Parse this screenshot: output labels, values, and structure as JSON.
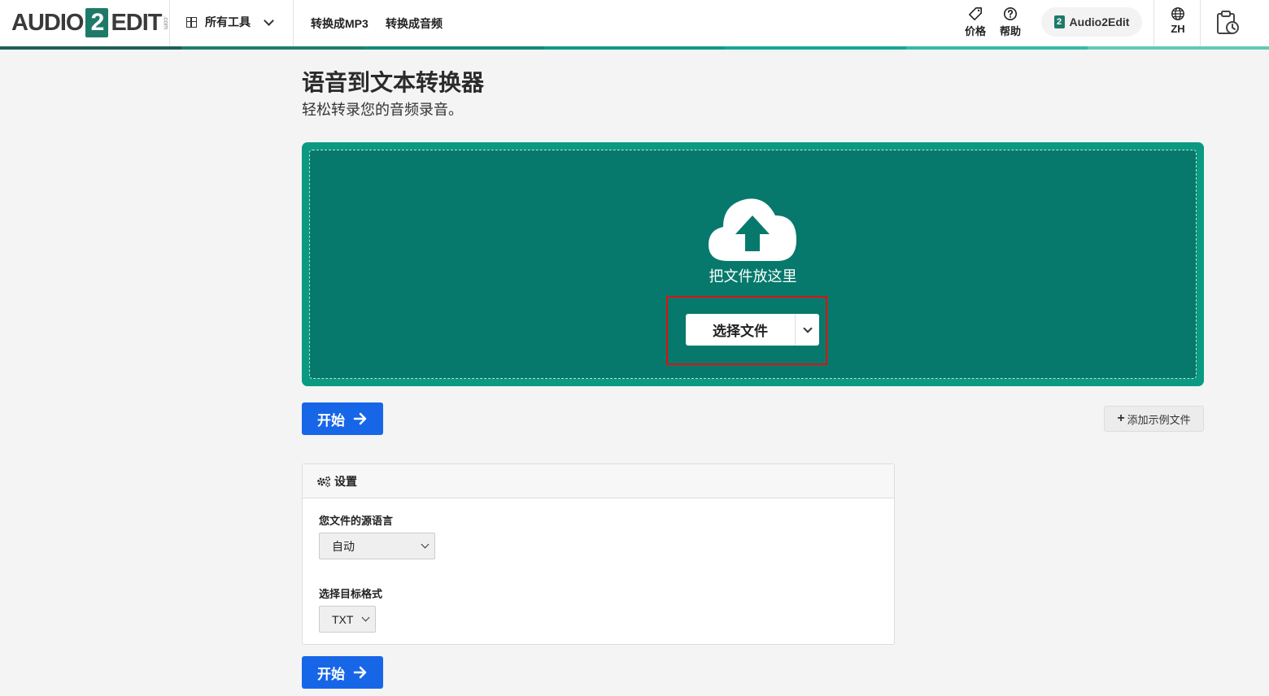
{
  "header": {
    "logo_left": "AUDIO",
    "logo_two": "2",
    "logo_right": "EDIT",
    "logo_dotcom": ".com",
    "tools_label": "所有工具",
    "nav": [
      "转换成MP3",
      "转换成音频"
    ],
    "pricing_label": "价格",
    "help_label": "帮助",
    "brand_label": "Audio2Edit",
    "brand_mini": "2",
    "lang_label": "ZH",
    "stripe_colors": [
      "#1e5f55",
      "#1f7d6c",
      "#13887a",
      "#0f9a88",
      "#12a896",
      "#35b9a7",
      "#5fcab8"
    ]
  },
  "page": {
    "title": "语音到文本转换器",
    "subtitle": "轻松转录您的音频录音。"
  },
  "dropzone": {
    "drop_text": "把文件放这里",
    "choose_label": "选择文件",
    "outer_color": "#0a9a82",
    "inner_color": "#06796c"
  },
  "actions": {
    "start_label": "开始",
    "sample_label": "添加示例文件",
    "sample_plus": "+"
  },
  "settings": {
    "header": "设置",
    "source_lang_label": "您文件的源语言",
    "source_lang_value": "自动",
    "target_format_label": "选择目标格式",
    "target_format_value": "TXT"
  },
  "colors": {
    "primary_blue": "#1766e8",
    "brand_green": "#1d7a68",
    "highlight_red": "#e01010"
  }
}
